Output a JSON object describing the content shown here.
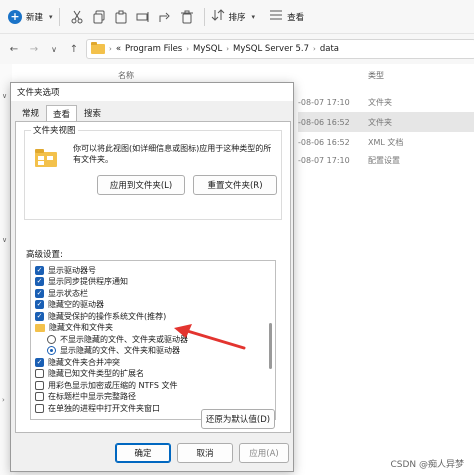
{
  "toolbar": {
    "new_label": "新建",
    "sort_label": "排序",
    "view_label": "查看",
    "icons": [
      "cut-icon",
      "copy-icon",
      "paste-icon",
      "rename-icon",
      "share-icon",
      "delete-icon",
      "sort-icon",
      "view-icon"
    ]
  },
  "address": {
    "overflow": "«",
    "crumbs": [
      "Program Files",
      "MySQL",
      "MySQL Server 5.7",
      "data"
    ]
  },
  "filelist": {
    "col_name": "名称",
    "col_type": "类型",
    "rows": [
      {
        "date": "-08-07 17:10",
        "type": "文件夹"
      },
      {
        "date": "-08-06 16:52",
        "type": "文件夹"
      },
      {
        "date": "-08-06 16:52",
        "type": "XML 文档"
      },
      {
        "date": "-08-07 17:10",
        "type": "配置设置"
      }
    ]
  },
  "dialog": {
    "title": "文件夹选项",
    "tabs": [
      "常规",
      "查看",
      "搜索"
    ],
    "active_tab": 1,
    "folder_views": {
      "title": "文件夹视图",
      "desc": "你可以将此视图(如详细信息或图标)应用于这种类型的所有文件夹。",
      "apply_btn": "应用到文件夹(L)",
      "reset_btn": "重置文件夹(R)"
    },
    "advanced_label": "高级设置:",
    "advanced_items": [
      {
        "kind": "checkbox",
        "checked": true,
        "indent": 0,
        "label": "显示驱动器号"
      },
      {
        "kind": "checkbox",
        "checked": true,
        "indent": 0,
        "label": "显示同步提供程序通知"
      },
      {
        "kind": "checkbox",
        "checked": true,
        "indent": 0,
        "label": "显示状态栏"
      },
      {
        "kind": "checkbox",
        "checked": true,
        "indent": 0,
        "label": "隐藏空的驱动器"
      },
      {
        "kind": "checkbox",
        "checked": true,
        "indent": 0,
        "label": "隐藏受保护的操作系统文件(推荐)"
      },
      {
        "kind": "folder",
        "indent": 0,
        "label": "隐藏文件和文件夹"
      },
      {
        "kind": "radio",
        "checked": false,
        "indent": 1,
        "label": "不显示隐藏的文件、文件夹或驱动器"
      },
      {
        "kind": "radio",
        "checked": true,
        "indent": 1,
        "label": "显示隐藏的文件、文件夹和驱动器"
      },
      {
        "kind": "checkbox",
        "checked": true,
        "indent": 0,
        "label": "隐藏文件夹合并冲突"
      },
      {
        "kind": "checkbox",
        "checked": false,
        "indent": 0,
        "label": "隐藏已知文件类型的扩展名"
      },
      {
        "kind": "checkbox",
        "checked": false,
        "indent": 0,
        "label": "用彩色显示加密或压缩的 NTFS 文件"
      },
      {
        "kind": "checkbox",
        "checked": false,
        "indent": 0,
        "label": "在标题栏中显示完整路径"
      },
      {
        "kind": "checkbox",
        "checked": false,
        "indent": 0,
        "label": "在单独的进程中打开文件夹窗口"
      }
    ],
    "restore_btn": "还原为默认值(D)",
    "ok_btn": "确定",
    "cancel_btn": "取消",
    "apply_btn": "应用(A)"
  },
  "annotation": {
    "arrow_color": "#e3342f"
  },
  "watermark": "CSDN @痴人异梦",
  "colors": {
    "accent": "#1a5fb4",
    "folder": "#f3c14b"
  }
}
